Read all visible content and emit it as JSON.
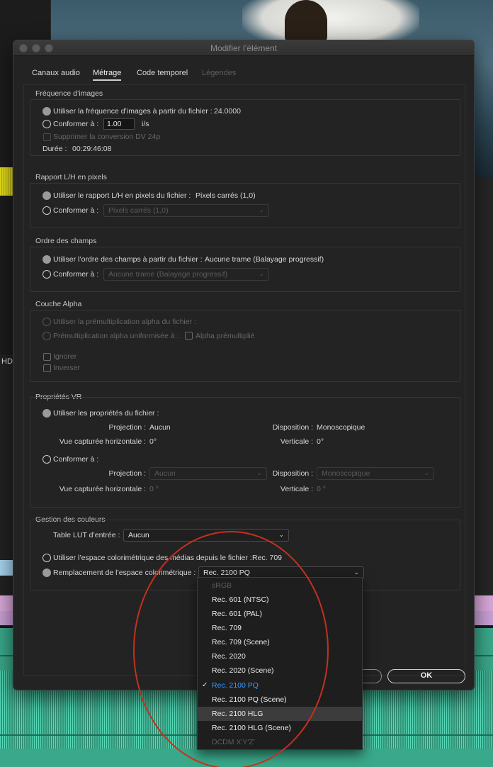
{
  "background": {
    "hd_label": "HD"
  },
  "dialog": {
    "title": "Modifier l’élément",
    "tabs": [
      {
        "label": "Canaux audio",
        "state": "normal"
      },
      {
        "label": "Métrage",
        "state": "active"
      },
      {
        "label": "Code temporel",
        "state": "normal"
      },
      {
        "label": "Légendes",
        "state": "disabled"
      }
    ],
    "frame_rate": {
      "title": "Fréquence d’images",
      "use_file": "Utiliser la fréquence d’images à partir du fichier :",
      "file_value": "24.0000",
      "conform": "Conformer à :",
      "conform_value": "1.00",
      "unit": "i/s",
      "remove_dv": "Supprimer la conversion DV 24p",
      "duration_label": "Durée :",
      "duration_value": "00:29:46:08"
    },
    "pixel_aspect": {
      "title": "Rapport L/H en pixels",
      "use_file": "Utiliser le rapport L/H en pixels du fichier :",
      "file_value": "Pixels carrés (1,0)",
      "conform": "Conformer à :",
      "select_value": "Pixels carrés (1,0)"
    },
    "field_order": {
      "title": "Ordre des champs",
      "use_file": "Utiliser l’ordre des champs à partir du fichier :",
      "file_value": "Aucune trame (Balayage progressif)",
      "conform": "Conformer à :",
      "select_value": "Aucune trame (Balayage progressif)"
    },
    "alpha": {
      "title": "Couche Alpha",
      "use_file": "Utiliser la prémultiplication alpha du fichier :",
      "uniform": "Prémultiplication alpha uniformisée à :",
      "premultiplied": "Alpha prémultiplié",
      "ignore": "Ignorer",
      "invert": "Inverser"
    },
    "vr": {
      "title": "Propriétés VR",
      "use_file": "Utiliser les propriétés du fichier :",
      "projection_label": "Projection :",
      "projection_value": "Aucun",
      "layout_label": "Disposition :",
      "layout_value": "Monoscopique",
      "h_capture_label": "Vue capturée horizontale :",
      "h_capture_value": "0°",
      "vertical_label": "Verticale :",
      "vertical_value": "0°",
      "conform": "Conformer à :",
      "projection_select": "Aucun",
      "layout_select": "Monoscopique",
      "h_capture_value2": "0 °",
      "vertical_value2": "0 °"
    },
    "color": {
      "title": "Gestion des couleurs",
      "lut_label": "Table LUT d’entrée :",
      "lut_value": "Aucun",
      "use_media": "Utiliser l’espace colorimétrique des médias depuis le fichier :",
      "media_value": "Rec. 709",
      "override": "Remplacement de l’espace colorimétrique :",
      "override_value": "Rec. 2100 PQ"
    },
    "ok_label": "OK"
  },
  "menu": {
    "items": [
      {
        "label": "sRGB",
        "state": "disabled"
      },
      {
        "label": "Rec. 601 (NTSC)",
        "state": "normal"
      },
      {
        "label": "Rec. 601 (PAL)",
        "state": "normal"
      },
      {
        "label": "Rec. 709",
        "state": "normal"
      },
      {
        "label": "Rec. 709 (Scene)",
        "state": "normal"
      },
      {
        "label": "Rec. 2020",
        "state": "normal"
      },
      {
        "label": "Rec. 2020 (Scene)",
        "state": "normal"
      },
      {
        "label": "Rec. 2100 PQ",
        "state": "selected",
        "check": "✓"
      },
      {
        "label": "Rec. 2100 PQ (Scene)",
        "state": "normal"
      },
      {
        "label": "Rec. 2100 HLG",
        "state": "hover"
      },
      {
        "label": "Rec. 2100 HLG (Scene)",
        "state": "normal"
      },
      {
        "label": "DCDM X'Y'Z'",
        "state": "disabled"
      }
    ]
  },
  "colors": {
    "accent_selected": "#3a9bff",
    "annotation_circle": "#c5301e"
  }
}
